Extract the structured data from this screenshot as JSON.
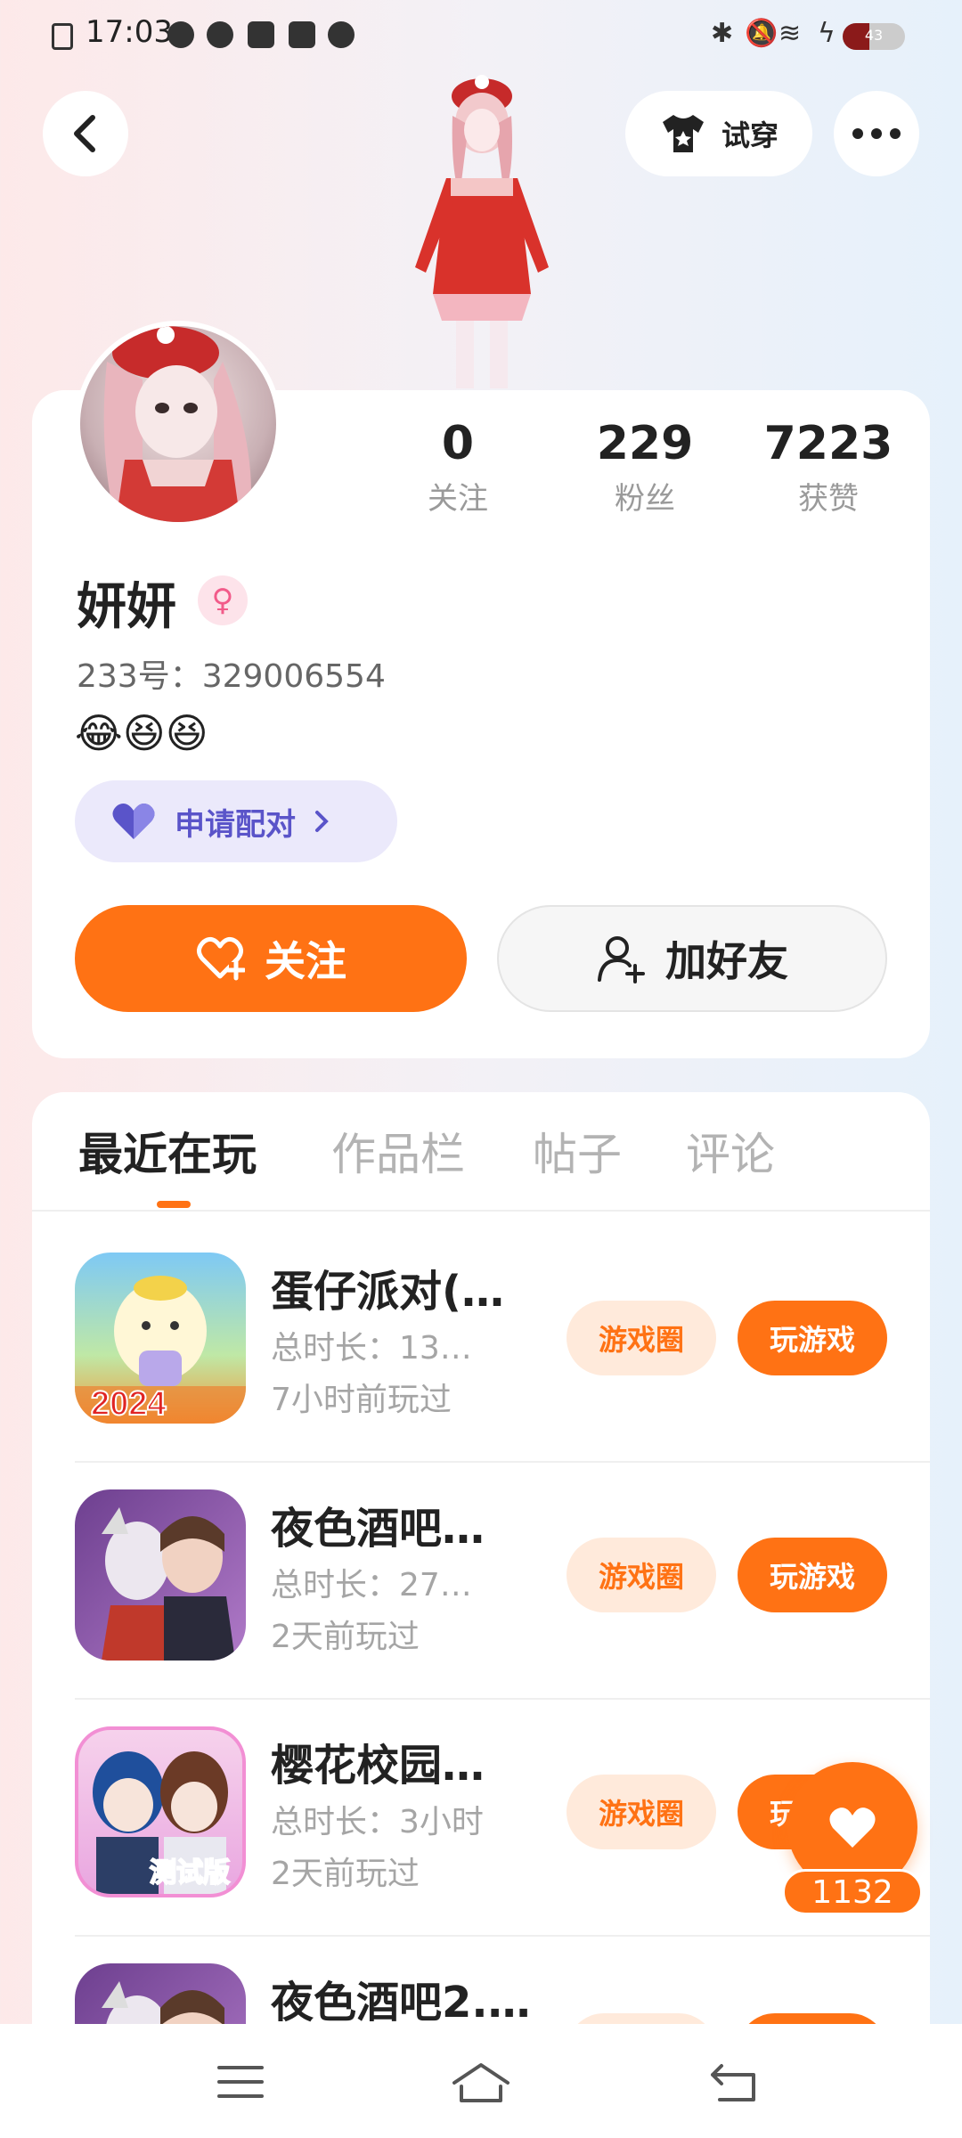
{
  "status_bar": {
    "time": "17:03",
    "battery_level": "43",
    "battery_fraction": 0.43
  },
  "header": {
    "try_on_label": "试穿",
    "icons": [
      "back-icon",
      "shirt-icon",
      "more-icon"
    ]
  },
  "profile": {
    "stats": [
      {
        "value": "0",
        "label": "关注"
      },
      {
        "value": "229",
        "label": "粉丝"
      },
      {
        "value": "7223",
        "label": "获赞"
      }
    ],
    "username": "妍妍",
    "gender_symbol": "♀",
    "id_line": "233号：329006554",
    "emojis": "😂😆😆",
    "pair_label": "申请配对",
    "follow_label": "关注",
    "add_friend_label": "加好友"
  },
  "tabs": [
    "最近在玩",
    "作品栏",
    "帖子",
    "评论"
  ],
  "games": [
    {
      "title": "蛋仔派对(…",
      "duration": "总时长：13…",
      "last_played": "7小时前玩过",
      "icon_text": "2024",
      "circle_label": "游戏圈",
      "play_label": "玩游戏"
    },
    {
      "title": "夜色酒吧…",
      "duration": "总时长：27…",
      "last_played": "2天前玩过",
      "icon_text": "",
      "circle_label": "游戏圈",
      "play_label": "玩游戏"
    },
    {
      "title": "樱花校园…",
      "duration": "总时长：3小时",
      "last_played": "2天前玩过",
      "icon_text": "测试版",
      "circle_label": "游戏圈",
      "play_label": "玩游戏"
    },
    {
      "title": "夜色酒吧2.…",
      "duration": "",
      "last_played": "",
      "icon_text": "",
      "circle_label": "",
      "play_label": ""
    }
  ],
  "float_like": {
    "count": "1132"
  },
  "colors": {
    "accent": "#ff7214",
    "accent_light": "#ffeadb",
    "pair_bg": "#ebe9fb",
    "pair_text": "#5a54c9"
  }
}
